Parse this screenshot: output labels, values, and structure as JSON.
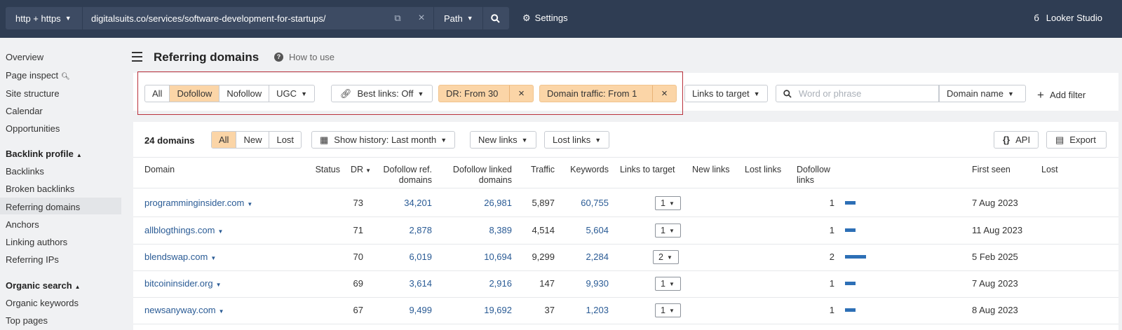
{
  "topbar": {
    "protocol": "http + https",
    "url": "digitalsuits.co/services/software-development-for-startups/",
    "path_mode": "Path",
    "settings_label": "Settings",
    "looker_label": "Looker Studio"
  },
  "sidebar": {
    "items_top": [
      "Overview",
      "Page inspect",
      "Site structure",
      "Calendar",
      "Opportunities"
    ],
    "backlink_head": "Backlink profile",
    "backlink_items": [
      "Backlinks",
      "Broken backlinks",
      "Referring domains",
      "Anchors",
      "Linking authors",
      "Referring IPs"
    ],
    "organic_head": "Organic search",
    "organic_items": [
      "Organic keywords",
      "Top pages"
    ]
  },
  "header": {
    "title": "Referring domains",
    "how_to_use": "How to use"
  },
  "filters": {
    "type_options": [
      "All",
      "Dofollow",
      "Nofollow",
      "UGC"
    ],
    "type_selected": "Dofollow",
    "best_links": "Best links: Off",
    "dr_filter": "DR: From 30",
    "traffic_filter": "Domain traffic: From 1",
    "links_to_target": "Links to target",
    "search_placeholder": "Word or phrase",
    "search_scope": "Domain name",
    "add_filter": "Add filter"
  },
  "table_toolbar": {
    "count": "24 domains",
    "status_tabs": [
      "All",
      "New",
      "Lost"
    ],
    "status_selected": "All",
    "history": "Show history: Last month",
    "new_links": "New links",
    "lost_links": "Lost links",
    "api": "API",
    "export": "Export"
  },
  "columns": {
    "domain": "Domain",
    "status": "Status",
    "dr": "DR",
    "dofollow_ref_1": "Dofollow ref.",
    "dofollow_ref_2": "domains",
    "dofollow_linked_1": "Dofollow linked",
    "dofollow_linked_2": "domains",
    "traffic": "Traffic",
    "keywords": "Keywords",
    "links_to_target": "Links to target",
    "new_links": "New links",
    "lost_links": "Lost links",
    "dofollow_links_1": "Dofollow",
    "dofollow_links_2": "links",
    "first_seen": "First seen",
    "lost": "Lost"
  },
  "rows": [
    {
      "domain": "programminginsider.com",
      "dr": "73",
      "ref_domains": "34,201",
      "linked_domains": "26,981",
      "traffic": "5,897",
      "keywords": "60,755",
      "links_to_target": "1",
      "dofollow_links": "1",
      "bar_fraction": 0.5,
      "first_seen": "7 Aug 2023"
    },
    {
      "domain": "allblogthings.com",
      "dr": "71",
      "ref_domains": "2,878",
      "linked_domains": "8,389",
      "traffic": "4,514",
      "keywords": "5,604",
      "links_to_target": "1",
      "dofollow_links": "1",
      "bar_fraction": 0.5,
      "first_seen": "11 Aug 2023"
    },
    {
      "domain": "blendswap.com",
      "dr": "70",
      "ref_domains": "6,019",
      "linked_domains": "10,694",
      "traffic": "9,299",
      "keywords": "2,284",
      "links_to_target": "2",
      "dofollow_links": "2",
      "bar_fraction": 1.0,
      "first_seen": "5 Feb 2025"
    },
    {
      "domain": "bitcoininsider.org",
      "dr": "69",
      "ref_domains": "3,614",
      "linked_domains": "2,916",
      "traffic": "147",
      "keywords": "9,930",
      "links_to_target": "1",
      "dofollow_links": "1",
      "bar_fraction": 0.5,
      "first_seen": "7 Aug 2023"
    },
    {
      "domain": "newsanyway.com",
      "dr": "67",
      "ref_domains": "9,499",
      "linked_domains": "19,692",
      "traffic": "37",
      "keywords": "1,203",
      "links_to_target": "1",
      "dofollow_links": "1",
      "bar_fraction": 0.5,
      "first_seen": "8 Aug 2023"
    }
  ],
  "colors": {
    "topbar": "#2f3d53",
    "accent_orange": "#fbd5a7",
    "link_blue": "#2a5b95",
    "highlight_box": "#b9313c"
  }
}
